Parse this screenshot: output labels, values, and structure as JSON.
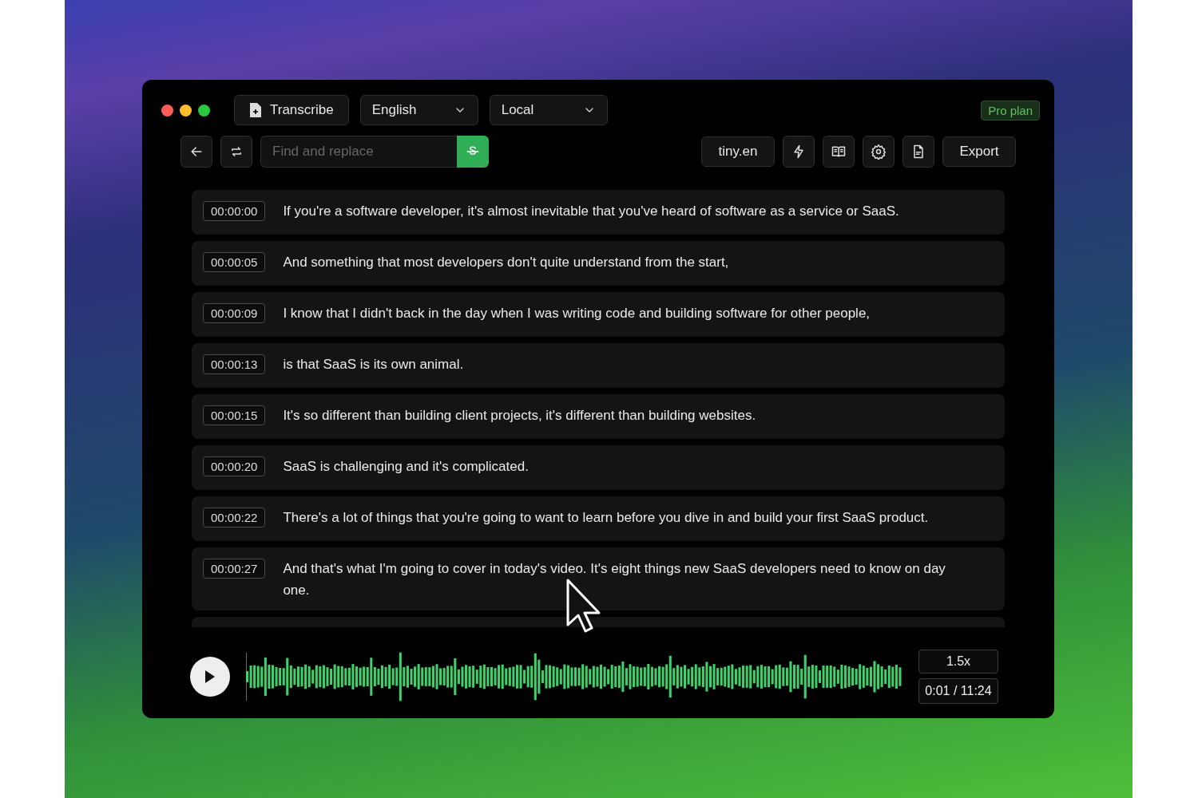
{
  "window": {
    "badge": "Pro plan"
  },
  "toolbar": {
    "transcribe": "Transcribe",
    "language": "English",
    "engine": "Local",
    "search": {
      "placeholder": "Find and replace"
    },
    "model": "tiny.en",
    "export": "Export"
  },
  "segments": [
    {
      "time": "00:00:00",
      "text": "If you're a software developer, it's almost inevitable that you've heard of software as a service or SaaS."
    },
    {
      "time": "00:00:05",
      "text": "And something that most developers don't quite understand from the start,"
    },
    {
      "time": "00:00:09",
      "text": "I know that I didn't back in the day when I was writing code and building software for other people,"
    },
    {
      "time": "00:00:13",
      "text": "is that SaaS is its own animal."
    },
    {
      "time": "00:00:15",
      "text": "It's so different than building client projects, it's different than building websites."
    },
    {
      "time": "00:00:20",
      "text": "SaaS is challenging and it's complicated."
    },
    {
      "time": "00:00:22",
      "text": "There's a lot of things that you're going to want to learn before you dive in and build your first SaaS product."
    },
    {
      "time": "00:00:27",
      "text": "And that's what I'm going to cover in today's video. It's eight things new SaaS developers need to know on day one."
    }
  ],
  "player": {
    "speed": "1.5x",
    "time": "0:01 / 11:24"
  }
}
